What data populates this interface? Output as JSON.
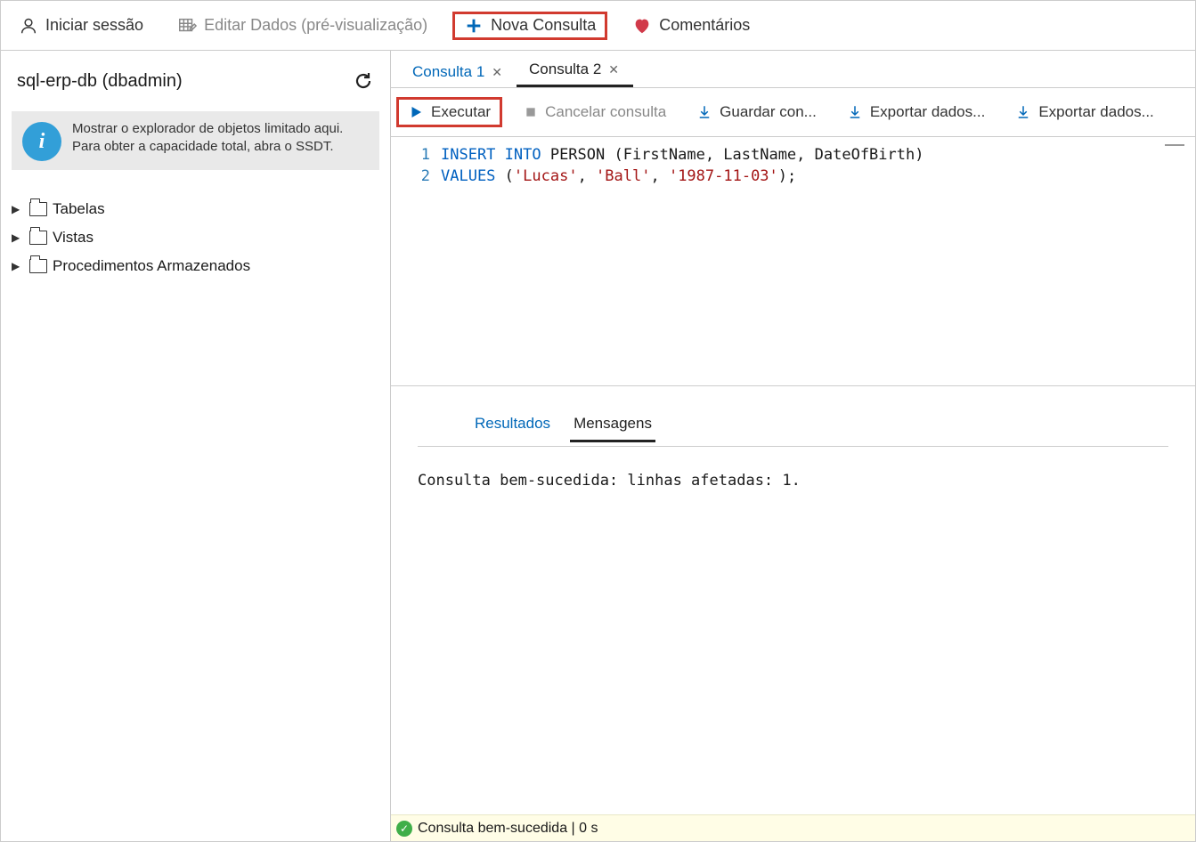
{
  "topbar": {
    "signin": "Iniciar sessão",
    "editdata": "Editar Dados (pré-visualização)",
    "newquery": "Nova Consulta",
    "comments": "Comentários"
  },
  "sidebar": {
    "connection": "sql-erp-db (dbadmin)",
    "info_text": "Mostrar o explorador de objetos limitado aqui. Para obter a capacidade total, abra o SSDT.",
    "tree": {
      "tables": "Tabelas",
      "views": "Vistas",
      "sprocs": "Procedimentos Armazenados"
    }
  },
  "tabs": {
    "tab1": "Consulta 1",
    "tab2": "Consulta 2"
  },
  "toolbar": {
    "execute": "Executar",
    "cancel": "Cancelar consulta",
    "saveas": "Guardar con...",
    "export1": "Exportar dados...",
    "export2": "Exportar dados..."
  },
  "editor": {
    "line1_kw1": "INSERT INTO",
    "line1_rest": " PERSON (FirstName, LastName, DateOfBirth)",
    "line2_kw1": "VALUES",
    "line2_p1": " (",
    "line2_s1": "'Lucas'",
    "line2_c1": ", ",
    "line2_s2": "'Ball'",
    "line2_c2": ", ",
    "line2_s3": "'1987-11-03'",
    "line2_p2": ");",
    "ln1": "1",
    "ln2": "2"
  },
  "result_tabs": {
    "results": "Resultados",
    "messages": "Mensagens"
  },
  "result_message": "Consulta bem-sucedida: linhas afetadas: 1.",
  "status": {
    "text": "Consulta bem-sucedida",
    "time": "0 s"
  }
}
